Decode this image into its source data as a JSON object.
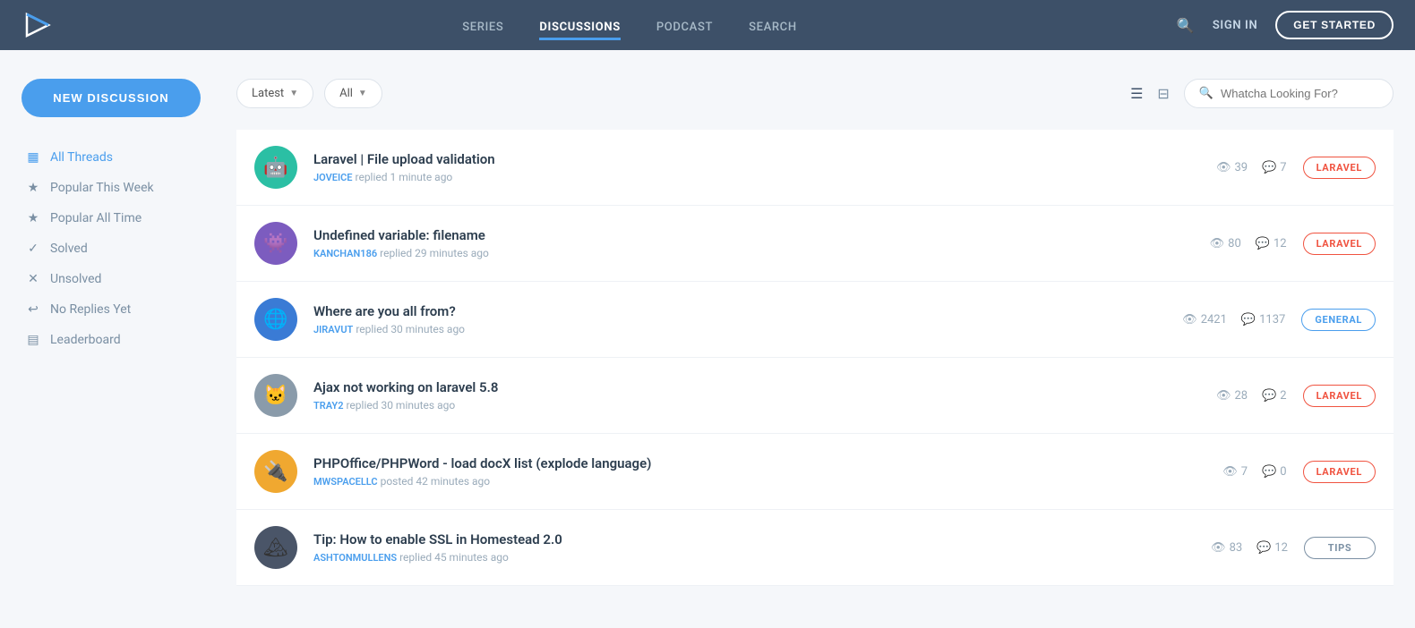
{
  "nav": {
    "links": [
      {
        "id": "series",
        "label": "SERIES",
        "active": false
      },
      {
        "id": "discussions",
        "label": "DISCUSSIONS",
        "active": true
      },
      {
        "id": "podcast",
        "label": "PODCAST",
        "active": false
      },
      {
        "id": "search",
        "label": "SEARCH",
        "active": false
      }
    ],
    "signin": "SIGN IN",
    "getstarted": "GET STARTED"
  },
  "sidebar": {
    "new_discussion": "NEW DISCUSSION",
    "items": [
      {
        "id": "all-threads",
        "label": "All Threads",
        "icon": "▦",
        "active": true
      },
      {
        "id": "popular-week",
        "label": "Popular This Week",
        "icon": "★",
        "active": false
      },
      {
        "id": "popular-all",
        "label": "Popular All Time",
        "icon": "★",
        "active": false
      },
      {
        "id": "solved",
        "label": "Solved",
        "icon": "✓",
        "active": false
      },
      {
        "id": "unsolved",
        "label": "Unsolved",
        "icon": "✕",
        "active": false
      },
      {
        "id": "no-replies",
        "label": "No Replies Yet",
        "icon": "↩",
        "active": false
      },
      {
        "id": "leaderboard",
        "label": "Leaderboard",
        "icon": "▤",
        "active": false
      }
    ]
  },
  "toolbar": {
    "sort_label": "Latest",
    "filter_label": "All",
    "search_placeholder": "Whatcha Looking For?"
  },
  "threads": [
    {
      "id": 1,
      "title": "Laravel | File upload validation",
      "author": "JOVEICE",
      "action": "replied",
      "time": "1 minute ago",
      "views": 39,
      "replies": 7,
      "tag": "LARAVEL",
      "tag_type": "laravel",
      "avatar_color": "teal",
      "avatar_emoji": "🤖"
    },
    {
      "id": 2,
      "title": "Undefined variable: filename",
      "author": "KANCHAN186",
      "action": "replied",
      "time": "29 minutes ago",
      "views": 80,
      "replies": 12,
      "tag": "LARAVEL",
      "tag_type": "laravel",
      "avatar_color": "purple",
      "avatar_emoji": "👾"
    },
    {
      "id": 3,
      "title": "Where are you all from?",
      "author": "JIRAVUT",
      "action": "replied",
      "time": "30 minutes ago",
      "views": 2421,
      "replies": 1137,
      "tag": "GENERAL",
      "tag_type": "general",
      "avatar_color": "blue",
      "avatar_emoji": "🌐"
    },
    {
      "id": 4,
      "title": "Ajax not working on laravel 5.8",
      "author": "TRAY2",
      "action": "replied",
      "time": "30 minutes ago",
      "views": 28,
      "replies": 2,
      "tag": "LARAVEL",
      "tag_type": "laravel",
      "avatar_color": "gray",
      "avatar_emoji": "🐱"
    },
    {
      "id": 5,
      "title": "PHPOffice/PHPWord - load docX list (explode language)",
      "author": "MWSPACELLC",
      "action": "posted",
      "time": "42 minutes ago",
      "views": 7,
      "replies": 0,
      "tag": "LARAVEL",
      "tag_type": "laravel",
      "avatar_color": "orange",
      "avatar_emoji": "🔌"
    },
    {
      "id": 6,
      "title": "Tip: How to enable SSL in Homestead 2.0",
      "author": "ASHTONMULLENS",
      "action": "replied",
      "time": "45 minutes ago",
      "views": 83,
      "replies": 12,
      "tag": "TIPS",
      "tag_type": "tips",
      "avatar_color": "dark",
      "avatar_emoji": "🏔"
    }
  ]
}
